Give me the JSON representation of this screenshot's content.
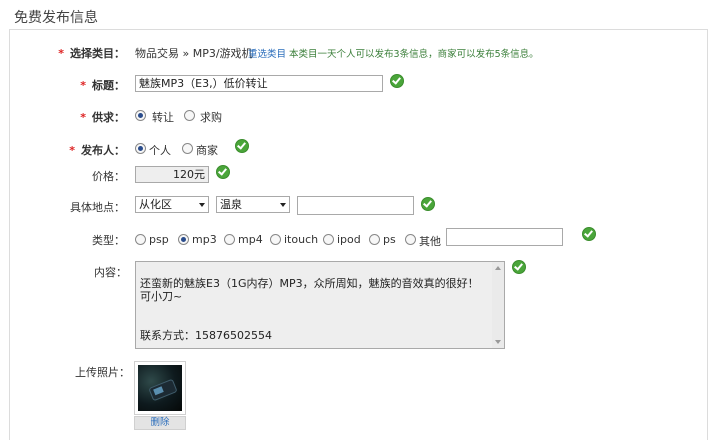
{
  "header": {
    "title": "免费发布信息"
  },
  "category": {
    "label": "选择类目：",
    "path": "物品交易 » MP3/游戏机",
    "reselect_link": "重选类目",
    "note": "本类目一天个人可以发布3条信息，商家可以发布5条信息。"
  },
  "title_field": {
    "label": "标题：",
    "value": "魅族MP3（E3,）低价转让"
  },
  "supply": {
    "label": "供求：",
    "options": [
      {
        "label": "转让",
        "checked": true
      },
      {
        "label": "求购",
        "checked": false
      }
    ]
  },
  "publisher": {
    "label": "发布人：",
    "options": [
      {
        "label": "个人",
        "checked": true
      },
      {
        "label": "商家",
        "checked": false
      }
    ]
  },
  "price": {
    "label": "价格：",
    "value": "120元"
  },
  "location": {
    "label": "具体地点：",
    "district": "从化区",
    "area": "温泉",
    "detail": ""
  },
  "type": {
    "label": "类型：",
    "options": [
      {
        "label": "psp",
        "checked": false
      },
      {
        "label": "mp3",
        "checked": true
      },
      {
        "label": "mp4",
        "checked": false
      },
      {
        "label": "itouch",
        "checked": false
      },
      {
        "label": "ipod",
        "checked": false
      },
      {
        "label": "ps",
        "checked": false
      },
      {
        "label": "其他",
        "checked": false
      }
    ],
    "other_value": ""
  },
  "content": {
    "label": "内容：",
    "value": "还蛮新的魅族E3（1G内存）MP3，众所周知，魅族的音效真的很好！\n可小刀~\n\n\n联系方式：15876502554"
  },
  "photo": {
    "label": "上传照片：",
    "delete_label": "删除"
  },
  "colors": {
    "required": "#dd2222",
    "check_ok": "#4aa53a",
    "link": "#2a6dbb",
    "note": "#3b7f3a"
  }
}
